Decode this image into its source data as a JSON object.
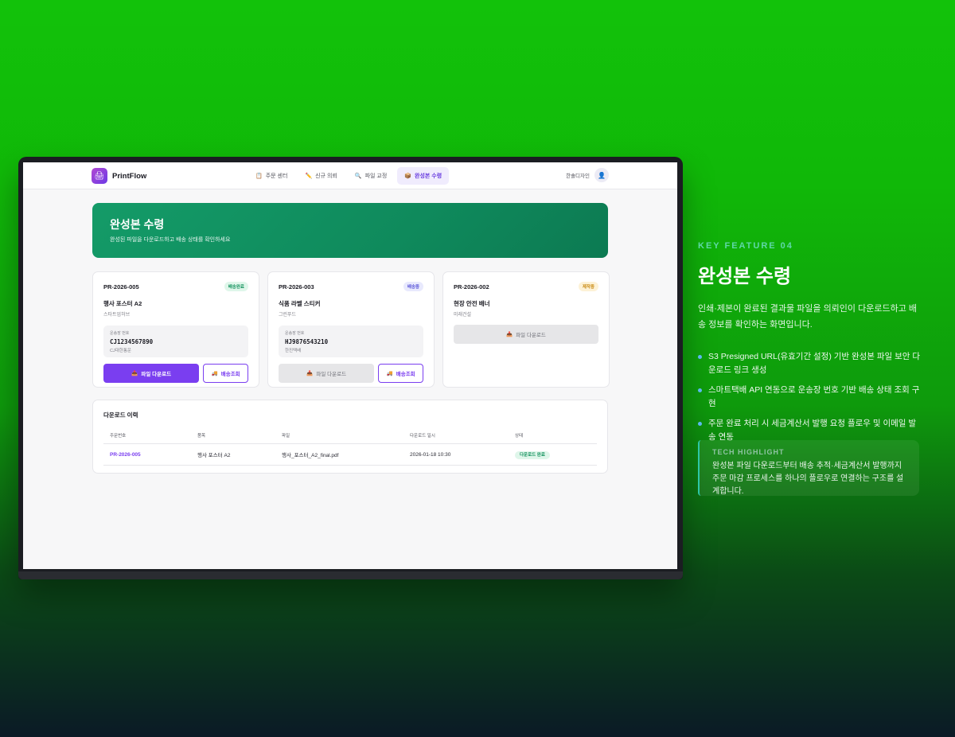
{
  "app": {
    "brand": "PrintFlow",
    "user_name": "한솔디자인"
  },
  "nav": {
    "tabs": [
      {
        "icon": "📋",
        "label": "주문 센터",
        "active": false
      },
      {
        "icon": "✏️",
        "label": "신규 의뢰",
        "active": false
      },
      {
        "icon": "🔍",
        "label": "파일 교정",
        "active": false
      },
      {
        "icon": "📦",
        "label": "완성본 수령",
        "active": true
      }
    ]
  },
  "hero": {
    "title": "완성본 수령",
    "subtitle": "완성된 파일을 다운로드하고 배송 상태를 확인하세요"
  },
  "orders": [
    {
      "id": "PR-2026-005",
      "status": "배송완료",
      "product": "행사 포스터 A2",
      "client": "스타트업허브",
      "tracking_label": "운송장 번호",
      "tracking_number": "CJ1234567890",
      "courier": "CJ대한통운",
      "download_label": "파일 다운로드",
      "track_label": "배송조회"
    },
    {
      "id": "PR-2026-003",
      "status": "배송중",
      "product": "식품 라벨 스티커",
      "client": "그린푸드",
      "tracking_label": "운송장 번호",
      "tracking_number": "HJ9876543210",
      "courier": "한진택배",
      "download_label": "파일 다운로드",
      "track_label": "배송조회"
    },
    {
      "id": "PR-2026-002",
      "status": "제작중",
      "product": "현장 안전 배너",
      "client": "미래건설",
      "download_label": "파일 다운로드"
    }
  ],
  "history": {
    "title": "다운로드 이력",
    "columns": [
      "주문번호",
      "품목",
      "파일",
      "다운로드 일시",
      "상태"
    ],
    "rows": [
      {
        "order": "PR-2026-005",
        "item": "행사 포스터 A2",
        "file": "행사_포스터_A2_final.pdf",
        "datetime": "2026-01-18 10:30",
        "status": "다운로드 완료"
      }
    ]
  },
  "feature": {
    "eyebrow": "KEY FEATURE 04",
    "title": "완성본 수령",
    "description": "인쇄·제본이 완료된 결과물 파일을 의뢰인이 다운로드하고 배송 정보를 확인하는 화면입니다.",
    "bullets": [
      "S3 Presigned URL(유효기간 설정) 기반 완성본 파일 보안 다운로드 링크 생성",
      "스마트택배 API 연동으로 운송장 번호 기반 배송 상태 조회 구현",
      "주문 완료 처리 시 세금계산서 발행 요청 플로우 및 이메일 발송 연동"
    ],
    "tech_label": "TECH HIGHLIGHT",
    "tech_text": "완성본 파일 다운로드부터 배송 추적·세금계산서 발행까지 주문 마감 프로세스를 하나의 플로우로 연결하는 구조를 설계합니다."
  },
  "colors": {
    "accent": "#7a3ef0",
    "hero_green": "#0f8a5c",
    "badge_green": "#14925e"
  }
}
